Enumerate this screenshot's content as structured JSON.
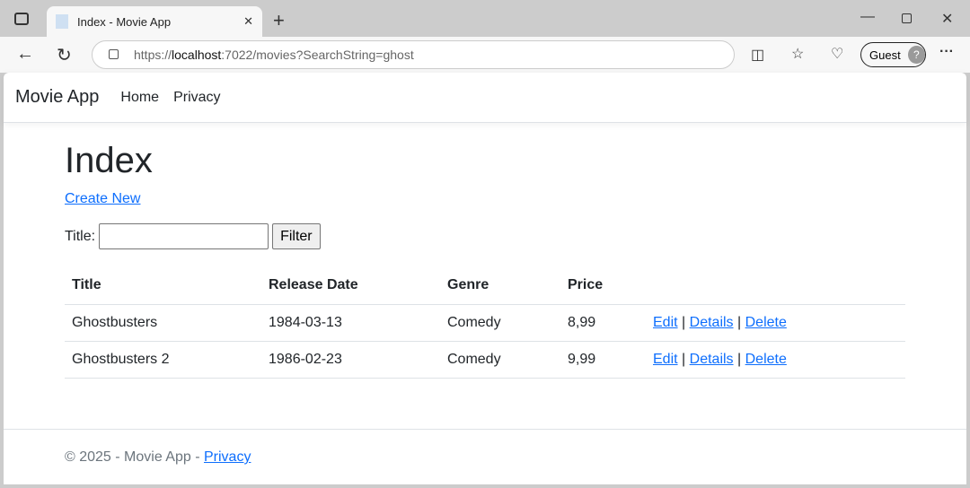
{
  "browser": {
    "tab_title": "Index - Movie App",
    "url_prefix": "https://",
    "url_host": "localhost",
    "url_rest": ":7022/movies?SearchString=ghost",
    "profile": "Guest"
  },
  "nav": {
    "brand": "Movie App",
    "links": [
      "Home",
      "Privacy"
    ]
  },
  "main": {
    "title": "Index",
    "create_new": "Create New",
    "filter_label": "Title:",
    "filter_value": "",
    "filter_button": "Filter",
    "columns": [
      "Title",
      "Release Date",
      "Genre",
      "Price"
    ],
    "rows": [
      {
        "title": "Ghostbusters",
        "date": "1984-03-13",
        "genre": "Comedy",
        "price": "8,99"
      },
      {
        "title": "Ghostbusters 2",
        "date": "1986-02-23",
        "genre": "Comedy",
        "price": "9,99"
      }
    ],
    "actions": {
      "edit": "Edit",
      "details": "Details",
      "delete": "Delete",
      "sep": "|"
    }
  },
  "footer": {
    "text": "© 2025 - Movie App - ",
    "link": "Privacy"
  }
}
